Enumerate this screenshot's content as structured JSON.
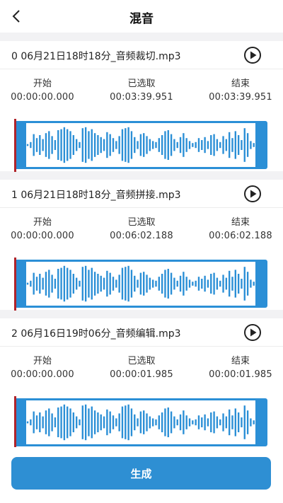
{
  "header": {
    "title": "混音",
    "back_icon": "chevron-left-icon"
  },
  "labels": {
    "start": "开始",
    "selected": "已选取",
    "end": "结束"
  },
  "tracks": [
    {
      "name": "0  06月21日18时18分_音频裁切.mp3",
      "start": "00:00:00.000",
      "selected": "00:03:39.951",
      "end": "00:03:39.951"
    },
    {
      "name": "1  06月21日18时18分_音频拼接.mp3",
      "start": "00:00:00.000",
      "selected": "00:06:02.188",
      "end": "00:06:02.188"
    },
    {
      "name": "2  06月16日19时06分_音频编辑.mp3",
      "start": "00:00:00.000",
      "selected": "00:00:01.985",
      "end": "00:00:01.985"
    }
  ],
  "footer": {
    "generate_label": "生成"
  },
  "colors": {
    "accent": "#2e8fd3",
    "marker": "#b0232a",
    "waveform": "#2b8fd6"
  }
}
